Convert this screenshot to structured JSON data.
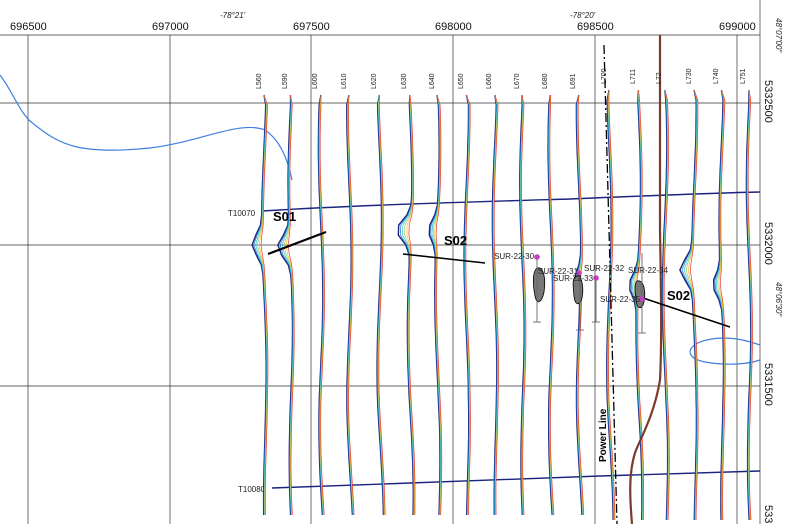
{
  "coords": {
    "easting": [
      "696500",
      "697000",
      "697500",
      "698000",
      "698500",
      "699000"
    ],
    "northing": [
      "5332500",
      "5332000",
      "5331500",
      "533"
    ],
    "longitude": [
      "-78°21'",
      "-78°20'"
    ],
    "latitude": [
      "48°07'00\"",
      "48°06'30\""
    ]
  },
  "lines": [
    "L560",
    "L590",
    "L600",
    "L610",
    "L620",
    "L630",
    "L640",
    "L650",
    "L660",
    "L670",
    "L680",
    "L691",
    "L700",
    "L711",
    "L72",
    "L730",
    "L740",
    "L751"
  ],
  "tie_lines": [
    "T10070",
    "T10080"
  ],
  "zones": [
    "S01",
    "S02",
    "S02"
  ],
  "drillholes": [
    "SUR-22-30",
    "SUR-22-31",
    "SUR-22-32",
    "SUR-22-33",
    "SUR-22-34",
    "SUR-22-35"
  ],
  "power_line_label": "Power Line",
  "colors": {
    "profile_line": "#1a237e",
    "creek": "#3f7fe0",
    "road": "#7b3b2a",
    "drill_collar": "#c040c0",
    "grid": "#333333"
  }
}
